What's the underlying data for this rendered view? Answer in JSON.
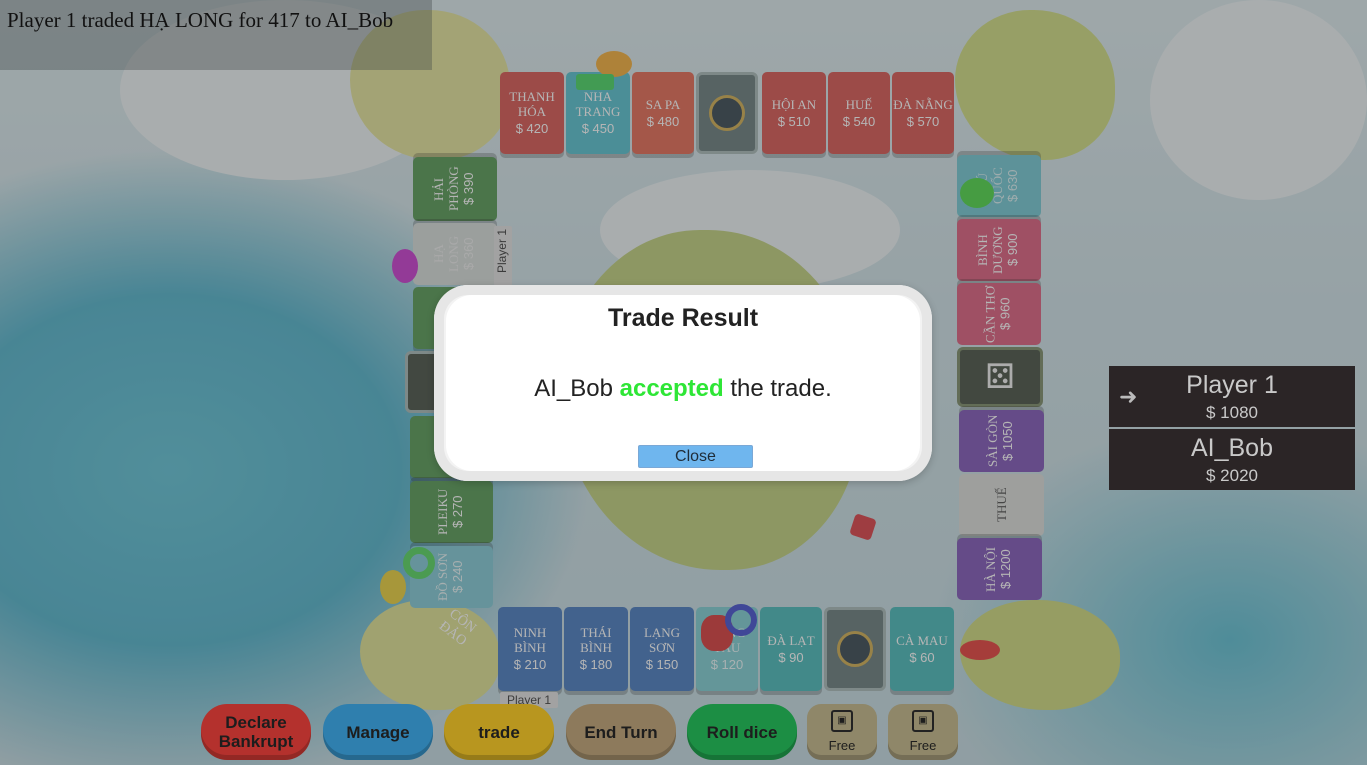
{
  "log": {
    "text": "Player 1 traded HẠ LONG for 417 to AI_Bob"
  },
  "dialog": {
    "title": "Trade Result",
    "msg_who": "AI_Bob",
    "msg_verb": "accepted",
    "msg_rest": "the trade.",
    "close_label": "Close"
  },
  "players": [
    {
      "name": "Player 1",
      "money": "$ 1080",
      "active": true
    },
    {
      "name": "AI_Bob",
      "money": "$ 2020",
      "active": false
    }
  ],
  "buttons": {
    "declare": "Declare\nBankrupt",
    "manage": "Manage",
    "trade": "trade",
    "end_turn": "End Turn",
    "roll": "Roll dice",
    "free1": "Free",
    "free2": "Free"
  },
  "board": {
    "top": [
      {
        "name": "THANH\nHÓA",
        "price": "$ 420"
      },
      {
        "name": "NHA\nTRANG",
        "price": "$ 450"
      },
      {
        "name": "SA PA",
        "price": "$ 480"
      },
      {
        "name": "HỘI AN",
        "price": "$ 510"
      },
      {
        "name": "HUẾ",
        "price": "$ 540"
      },
      {
        "name": "ĐÀ NẴNG",
        "price": "$ 570"
      }
    ],
    "left": [
      {
        "name": "HẢI\nPHÒNG",
        "price": "$ 390"
      },
      {
        "name": "HẠ\nLONG",
        "price": "$ 360"
      },
      {
        "name": "PLEIKU",
        "price": "$ 270"
      },
      {
        "name": "ĐỒ SƠN",
        "price": "$ 240"
      }
    ],
    "right": [
      {
        "name": "PHÚ\nQUỐC",
        "price": "$ 630"
      },
      {
        "name": "BÌNH\nDƯƠNG",
        "price": "$ 900"
      },
      {
        "name": "CẦN THƠ",
        "price": "$ 960"
      },
      {
        "name": "SÀI GÒN",
        "price": "$ 1050"
      },
      {
        "name": "THUẾ",
        "price": ""
      },
      {
        "name": "HÀ NỘI",
        "price": "$ 1200"
      }
    ],
    "bottom": [
      {
        "name": "NINH\nBÌNH",
        "price": "$ 210"
      },
      {
        "name": "THÁI BÌNH",
        "price": "$ 180"
      },
      {
        "name": "LẠNG\nSƠN",
        "price": "$ 150"
      },
      {
        "name": "VŨNG TÀU",
        "price": "$ 120"
      },
      {
        "name": "ĐÀ LẠT",
        "price": "$ 90"
      },
      {
        "name": "CÀ MAU",
        "price": "$ 60"
      }
    ],
    "corner_label": "CÔN\nĐẢO",
    "owner_tag": "Player 1"
  }
}
